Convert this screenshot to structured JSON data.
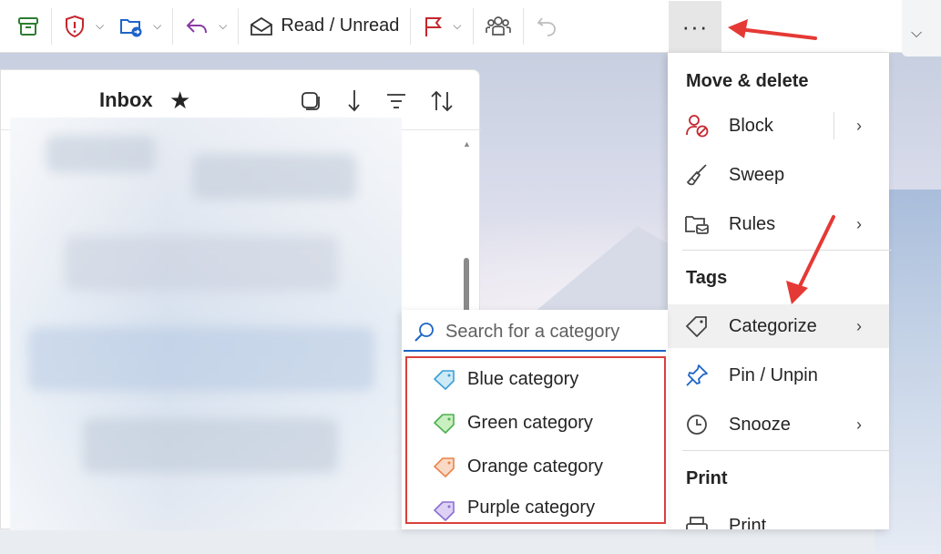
{
  "toolbar": {
    "read_unread_label": "Read / Unread",
    "more_label": "···"
  },
  "list": {
    "title": "Inbox"
  },
  "menu": {
    "section_move": "Move & delete",
    "section_tags": "Tags",
    "section_print": "Print",
    "items": [
      {
        "label": "Block",
        "icon": "block-icon",
        "submenu": true
      },
      {
        "label": "Sweep",
        "icon": "broom-icon",
        "submenu": false
      },
      {
        "label": "Rules",
        "icon": "rules-icon",
        "submenu": true
      },
      {
        "label": "Categorize",
        "icon": "tag-icon",
        "submenu": true
      },
      {
        "label": "Pin / Unpin",
        "icon": "pin-icon",
        "submenu": false
      },
      {
        "label": "Snooze",
        "icon": "clock-icon",
        "submenu": true
      },
      {
        "label": "Print",
        "icon": "printer-icon",
        "submenu": false
      }
    ]
  },
  "categorize": {
    "search_placeholder": "Search for a category",
    "categories": [
      {
        "label": "Blue category",
        "color": "#3a9fd8"
      },
      {
        "label": "Green category",
        "color": "#5cb85c"
      },
      {
        "label": "Orange category",
        "color": "#e8844a"
      },
      {
        "label": "Purple category",
        "color": "#8b6fd0"
      }
    ]
  },
  "colors": {
    "accent": "#1e64c8",
    "annotation_red": "#e53935",
    "icon_red": "#c4262e"
  }
}
